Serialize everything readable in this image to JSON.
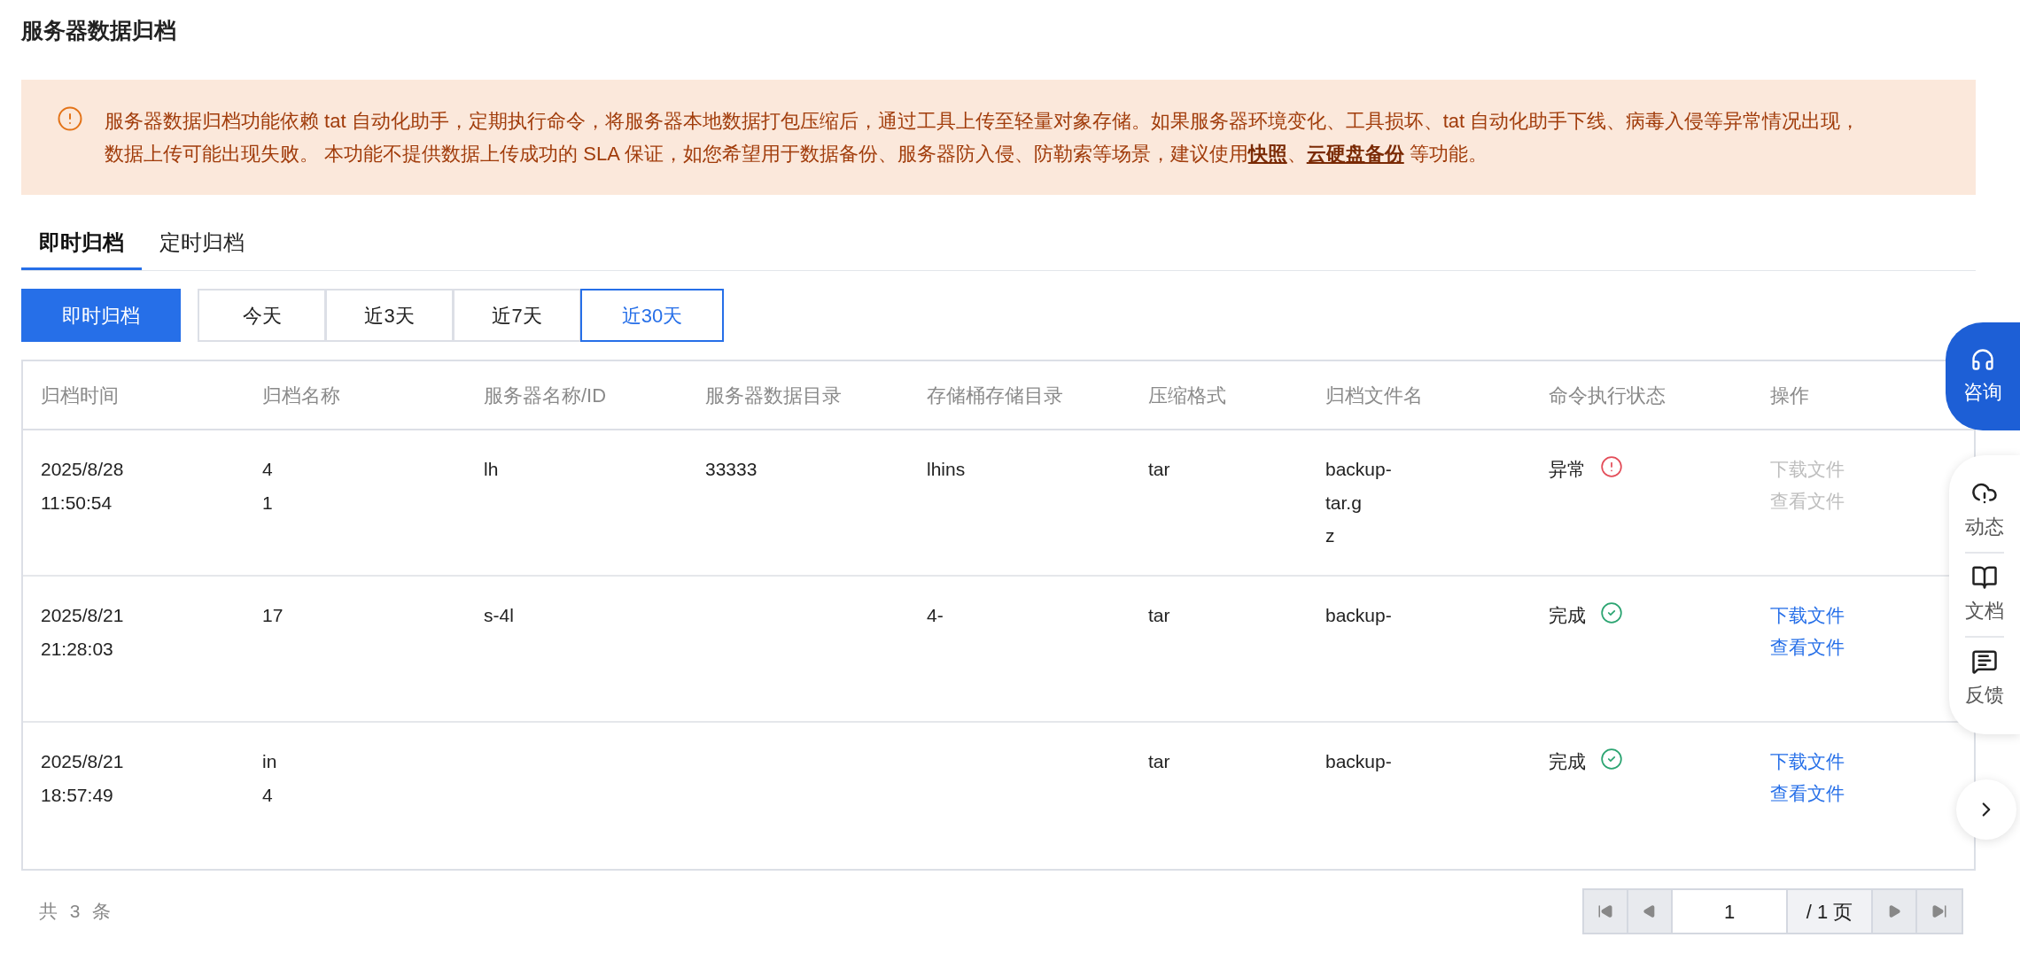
{
  "page_title": "服务器数据归档",
  "alert": {
    "parts": [
      {
        "kind": "text",
        "text": "服务器数据归档功能依赖 tat 自动化助手，定期执行命令，将服务器本地数据打包压缩后，通过工具上传至轻量对象存储。如果服务器环境变化、工具损坏、tat 自动化助手下线、病毒入侵等异常情况出现，数据上传可能出现失败。 本功能不提供数据上传成功的 SLA 保证，如您希望用于数据备份、服务器防入侵、防勒索等场景，建议使用"
      },
      {
        "kind": "link",
        "text": "快照"
      },
      {
        "kind": "text",
        "text": "、"
      },
      {
        "kind": "link",
        "text": "云硬盘备份"
      },
      {
        "kind": "text",
        "text": " 等功能。"
      }
    ]
  },
  "tabs": [
    {
      "label": "即时归档",
      "selected": true
    },
    {
      "label": "定时归档",
      "selected": false
    }
  ],
  "archive_button": "即时归档",
  "ranges": [
    {
      "label": "今天",
      "selected": false
    },
    {
      "label": "近3天",
      "selected": false
    },
    {
      "label": "近7天",
      "selected": false
    },
    {
      "label": "近30天",
      "selected": true
    }
  ],
  "table": {
    "columns": [
      "归档时间",
      "归档名称",
      "服务器名称/ID",
      "服务器数据目录",
      "存储桶存储目录",
      "压缩格式",
      "归档文件名",
      "命令执行状态",
      "操作"
    ],
    "rows": [
      {
        "time": [
          "2025/8/28",
          "11:50:54"
        ],
        "name": [
          "4",
          "1"
        ],
        "server": [
          "lh"
        ],
        "data_dir": [
          "33333"
        ],
        "bucket": [
          "lhins"
        ],
        "format": "tar",
        "file": [
          "backup-",
          "tar.g",
          "z"
        ],
        "status": {
          "label": "异常",
          "kind": "error"
        },
        "actions": [
          {
            "label": "下载文件",
            "disabled": true
          },
          {
            "label": "查看文件",
            "disabled": true
          }
        ]
      },
      {
        "time": [
          "2025/8/21",
          "21:28:03"
        ],
        "name": [
          "17"
        ],
        "server": [
          "s-4l"
        ],
        "data_dir": [],
        "bucket": [
          "4-"
        ],
        "format": "tar",
        "file": [
          "backup-"
        ],
        "status": {
          "label": "完成",
          "kind": "ok"
        },
        "actions": [
          {
            "label": "下载文件",
            "disabled": false
          },
          {
            "label": "查看文件",
            "disabled": false
          }
        ]
      },
      {
        "time": [
          "2025/8/21",
          "18:57:49"
        ],
        "name": [
          "in",
          "4"
        ],
        "server": [],
        "data_dir": [],
        "bucket": [],
        "format": "tar",
        "file": [
          "backup-"
        ],
        "status": {
          "label": "完成",
          "kind": "ok"
        },
        "actions": [
          {
            "label": "下载文件",
            "disabled": false
          },
          {
            "label": "查看文件",
            "disabled": false
          }
        ]
      }
    ]
  },
  "total": "共 3 条",
  "pagination": {
    "page": "1",
    "of": "/ 1 页"
  },
  "side": {
    "consult": "咨询",
    "items": [
      {
        "label": "动态",
        "kind": "news"
      },
      {
        "label": "文档",
        "kind": "docs"
      },
      {
        "label": "反馈",
        "kind": "feedback"
      }
    ]
  }
}
